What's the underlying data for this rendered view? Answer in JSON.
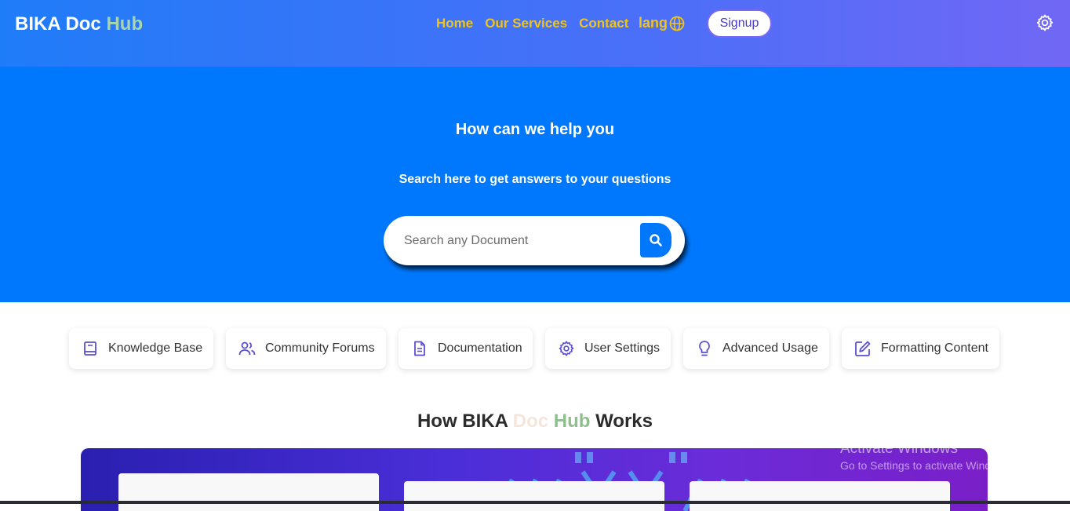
{
  "brand": {
    "part1": "BIKA Doc ",
    "part2": "Hub"
  },
  "nav": {
    "links": [
      "Home",
      "Our Services",
      "Contact"
    ],
    "lang": "lang",
    "signup": "Signup"
  },
  "hero": {
    "title": "How can we help you",
    "subtitle": "Search here to get answers to your questions",
    "search_placeholder": "Search any Document"
  },
  "categories": [
    {
      "label": "Knowledge Base",
      "icon": "book-icon"
    },
    {
      "label": "Community Forums",
      "icon": "users-icon"
    },
    {
      "label": "Documentation",
      "icon": "document-icon"
    },
    {
      "label": "User Settings",
      "icon": "gear-icon"
    },
    {
      "label": "Advanced Usage",
      "icon": "lightbulb-icon"
    },
    {
      "label": "Formatting Content",
      "icon": "edit-icon"
    }
  ],
  "how": {
    "part1": "How BIKA ",
    "doc": "Doc ",
    "hub": "Hub",
    "part2": " Works"
  },
  "watermark": {
    "title": "Activate Windows",
    "subtitle": "Go to Settings to activate Windows."
  },
  "colors": {
    "nav_link": "#f0c419",
    "hero_bg": "#0078fd",
    "icon": "#5b4fd1"
  }
}
